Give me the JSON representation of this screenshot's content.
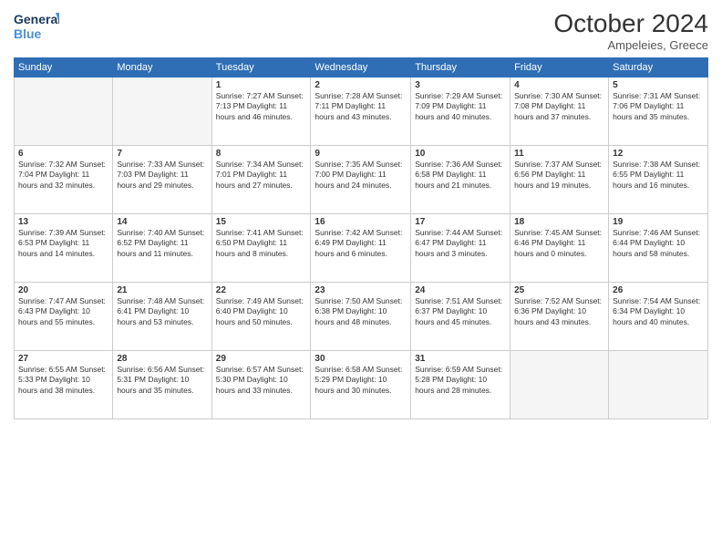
{
  "header": {
    "logo_line1": "General",
    "logo_line2": "Blue",
    "month": "October 2024",
    "location": "Ampeleies, Greece"
  },
  "weekdays": [
    "Sunday",
    "Monday",
    "Tuesday",
    "Wednesday",
    "Thursday",
    "Friday",
    "Saturday"
  ],
  "weeks": [
    [
      {
        "day": "",
        "info": ""
      },
      {
        "day": "",
        "info": ""
      },
      {
        "day": "1",
        "info": "Sunrise: 7:27 AM\nSunset: 7:13 PM\nDaylight: 11 hours\nand 46 minutes."
      },
      {
        "day": "2",
        "info": "Sunrise: 7:28 AM\nSunset: 7:11 PM\nDaylight: 11 hours\nand 43 minutes."
      },
      {
        "day": "3",
        "info": "Sunrise: 7:29 AM\nSunset: 7:09 PM\nDaylight: 11 hours\nand 40 minutes."
      },
      {
        "day": "4",
        "info": "Sunrise: 7:30 AM\nSunset: 7:08 PM\nDaylight: 11 hours\nand 37 minutes."
      },
      {
        "day": "5",
        "info": "Sunrise: 7:31 AM\nSunset: 7:06 PM\nDaylight: 11 hours\nand 35 minutes."
      }
    ],
    [
      {
        "day": "6",
        "info": "Sunrise: 7:32 AM\nSunset: 7:04 PM\nDaylight: 11 hours\nand 32 minutes."
      },
      {
        "day": "7",
        "info": "Sunrise: 7:33 AM\nSunset: 7:03 PM\nDaylight: 11 hours\nand 29 minutes."
      },
      {
        "day": "8",
        "info": "Sunrise: 7:34 AM\nSunset: 7:01 PM\nDaylight: 11 hours\nand 27 minutes."
      },
      {
        "day": "9",
        "info": "Sunrise: 7:35 AM\nSunset: 7:00 PM\nDaylight: 11 hours\nand 24 minutes."
      },
      {
        "day": "10",
        "info": "Sunrise: 7:36 AM\nSunset: 6:58 PM\nDaylight: 11 hours\nand 21 minutes."
      },
      {
        "day": "11",
        "info": "Sunrise: 7:37 AM\nSunset: 6:56 PM\nDaylight: 11 hours\nand 19 minutes."
      },
      {
        "day": "12",
        "info": "Sunrise: 7:38 AM\nSunset: 6:55 PM\nDaylight: 11 hours\nand 16 minutes."
      }
    ],
    [
      {
        "day": "13",
        "info": "Sunrise: 7:39 AM\nSunset: 6:53 PM\nDaylight: 11 hours\nand 14 minutes."
      },
      {
        "day": "14",
        "info": "Sunrise: 7:40 AM\nSunset: 6:52 PM\nDaylight: 11 hours\nand 11 minutes."
      },
      {
        "day": "15",
        "info": "Sunrise: 7:41 AM\nSunset: 6:50 PM\nDaylight: 11 hours\nand 8 minutes."
      },
      {
        "day": "16",
        "info": "Sunrise: 7:42 AM\nSunset: 6:49 PM\nDaylight: 11 hours\nand 6 minutes."
      },
      {
        "day": "17",
        "info": "Sunrise: 7:44 AM\nSunset: 6:47 PM\nDaylight: 11 hours\nand 3 minutes."
      },
      {
        "day": "18",
        "info": "Sunrise: 7:45 AM\nSunset: 6:46 PM\nDaylight: 11 hours\nand 0 minutes."
      },
      {
        "day": "19",
        "info": "Sunrise: 7:46 AM\nSunset: 6:44 PM\nDaylight: 10 hours\nand 58 minutes."
      }
    ],
    [
      {
        "day": "20",
        "info": "Sunrise: 7:47 AM\nSunset: 6:43 PM\nDaylight: 10 hours\nand 55 minutes."
      },
      {
        "day": "21",
        "info": "Sunrise: 7:48 AM\nSunset: 6:41 PM\nDaylight: 10 hours\nand 53 minutes."
      },
      {
        "day": "22",
        "info": "Sunrise: 7:49 AM\nSunset: 6:40 PM\nDaylight: 10 hours\nand 50 minutes."
      },
      {
        "day": "23",
        "info": "Sunrise: 7:50 AM\nSunset: 6:38 PM\nDaylight: 10 hours\nand 48 minutes."
      },
      {
        "day": "24",
        "info": "Sunrise: 7:51 AM\nSunset: 6:37 PM\nDaylight: 10 hours\nand 45 minutes."
      },
      {
        "day": "25",
        "info": "Sunrise: 7:52 AM\nSunset: 6:36 PM\nDaylight: 10 hours\nand 43 minutes."
      },
      {
        "day": "26",
        "info": "Sunrise: 7:54 AM\nSunset: 6:34 PM\nDaylight: 10 hours\nand 40 minutes."
      }
    ],
    [
      {
        "day": "27",
        "info": "Sunrise: 6:55 AM\nSunset: 5:33 PM\nDaylight: 10 hours\nand 38 minutes."
      },
      {
        "day": "28",
        "info": "Sunrise: 6:56 AM\nSunset: 5:31 PM\nDaylight: 10 hours\nand 35 minutes."
      },
      {
        "day": "29",
        "info": "Sunrise: 6:57 AM\nSunset: 5:30 PM\nDaylight: 10 hours\nand 33 minutes."
      },
      {
        "day": "30",
        "info": "Sunrise: 6:58 AM\nSunset: 5:29 PM\nDaylight: 10 hours\nand 30 minutes."
      },
      {
        "day": "31",
        "info": "Sunrise: 6:59 AM\nSunset: 5:28 PM\nDaylight: 10 hours\nand 28 minutes."
      },
      {
        "day": "",
        "info": ""
      },
      {
        "day": "",
        "info": ""
      }
    ]
  ]
}
